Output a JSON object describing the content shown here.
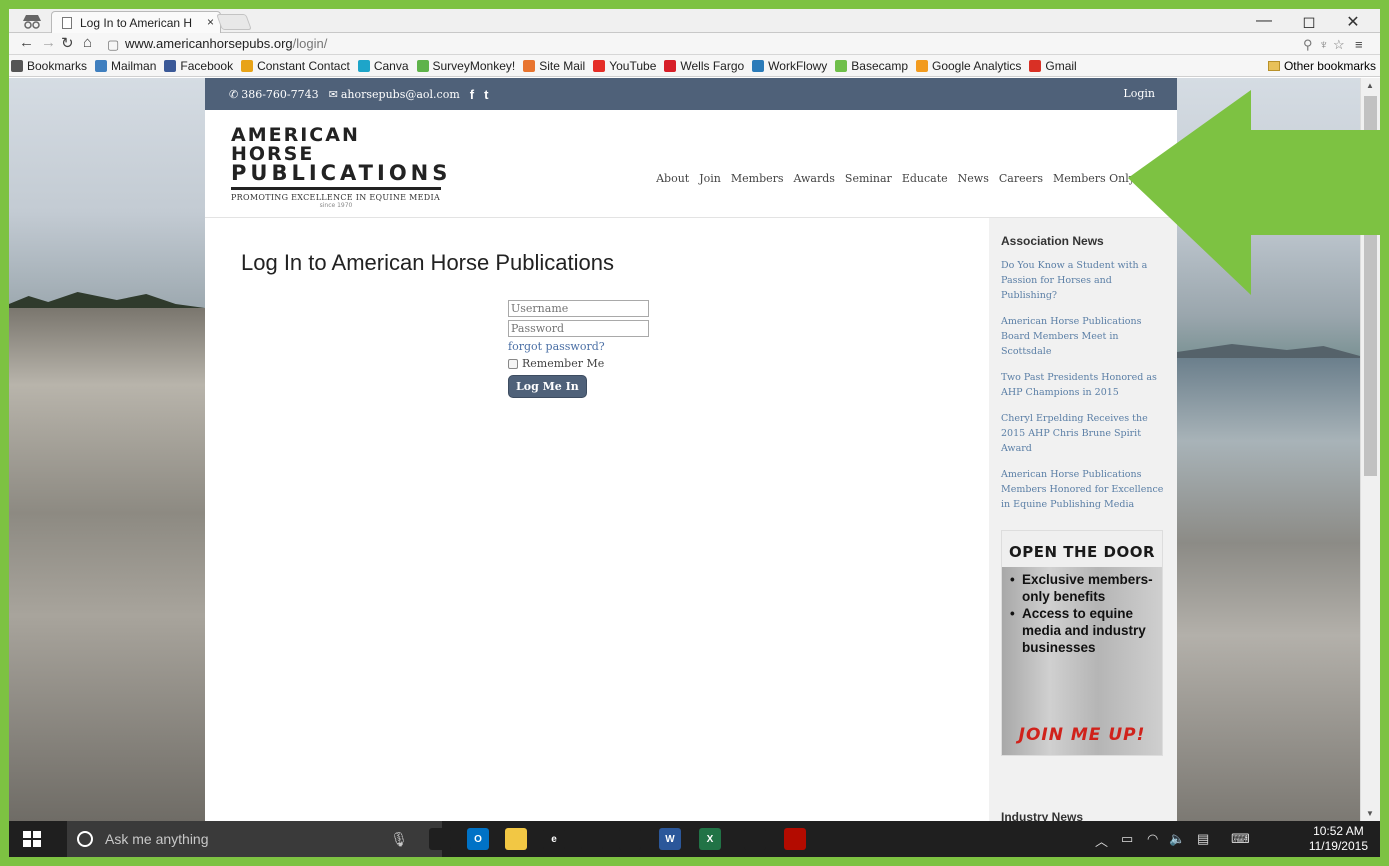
{
  "browser": {
    "tab_title": "Log In to American H",
    "tab_close": "×",
    "url_host": "www.americanhorsepubs.org",
    "url_path": "/login/",
    "window_controls": [
      "—",
      "◻",
      "✕"
    ],
    "bookmarks": [
      {
        "label": "Bookmarks",
        "icon": "star-icon",
        "color": "#555555"
      },
      {
        "label": "Mailman",
        "icon": "mailman-icon",
        "color": "#3f7fbf"
      },
      {
        "label": "Facebook",
        "icon": "facebook-icon",
        "color": "#3b5998"
      },
      {
        "label": "Constant Contact",
        "icon": "constant-contact-icon",
        "color": "#e8a317"
      },
      {
        "label": "Canva",
        "icon": "canva-icon",
        "color": "#1ea5c9"
      },
      {
        "label": "SurveyMonkey!",
        "icon": "surveymonkey-icon",
        "color": "#5fb34a"
      },
      {
        "label": "Site Mail",
        "icon": "site-mail-icon",
        "color": "#e8742f"
      },
      {
        "label": "YouTube",
        "icon": "youtube-icon",
        "color": "#e52d27"
      },
      {
        "label": "Wells Fargo",
        "icon": "wells-fargo-icon",
        "color": "#d71e28"
      },
      {
        "label": "WorkFlowy",
        "icon": "workflowy-icon",
        "color": "#2b7bb9"
      },
      {
        "label": "Basecamp",
        "icon": "basecamp-icon",
        "color": "#6fbf4a"
      },
      {
        "label": "Google Analytics",
        "icon": "google-analytics-icon",
        "color": "#f29b1f"
      },
      {
        "label": "Gmail",
        "icon": "gmail-icon",
        "color": "#d93025"
      }
    ],
    "other_bookmarks": "Other bookmarks"
  },
  "site": {
    "phone": "386-760-7743",
    "email": "ahorsepubs@aol.com",
    "social": [
      "f",
      "t"
    ],
    "login_link": "Login",
    "logo": {
      "line1": "AMERICAN HORSE",
      "line2": "PUBLICATIONS",
      "tagline": "PROMOTING EXCELLENCE IN EQUINE MEDIA",
      "since": "since 1970"
    },
    "nav": [
      "About",
      "Join",
      "Members",
      "Awards",
      "Seminar",
      "Educate",
      "News",
      "Careers",
      "Members Only"
    ],
    "page_title": "Log In to American Horse Publications",
    "form": {
      "username_placeholder": "Username",
      "password_placeholder": "Password",
      "forgot": "forgot password?",
      "remember": "Remember Me",
      "submit": "Log Me In"
    },
    "sidebar": {
      "heading": "Association News",
      "news": [
        "Do You Know a Student with a Passion for Horses and Publishing?",
        "American Horse Publications Board Members Meet in Scottsdale",
        "Two Past Presidents Honored as AHP Champions in 2015",
        "Cheryl Erpelding Receives the 2015 AHP Chris Brune Spirit Award",
        "American Horse Publications Members Honored for Excellence in Equine Publishing Media"
      ],
      "ad": {
        "headline": "OPEN THE DOOR",
        "bullets": [
          "Exclusive members-only benefits",
          "Access to equine media and industry businesses"
        ],
        "cta": "JOIN ME UP!"
      },
      "heading2": "Industry News"
    }
  },
  "taskbar": {
    "search_placeholder": "Ask me anything",
    "time": "10:52 AM",
    "date": "11/19/2015",
    "apps": [
      {
        "name": "task-view-icon",
        "label": "",
        "color": "#1f1f1f"
      },
      {
        "name": "outlook-icon",
        "label": "O",
        "color": "#0072c6"
      },
      {
        "name": "file-explorer-icon",
        "label": "",
        "color": "#f2c744"
      },
      {
        "name": "edge-icon",
        "label": "e",
        "color": "#1f1f1f"
      },
      {
        "name": "store-icon",
        "label": "",
        "color": "#1f1f1f"
      },
      {
        "name": "chrome-icon",
        "label": "",
        "color": "#1f1f1f"
      },
      {
        "name": "word-icon",
        "label": "W",
        "color": "#2b579a"
      },
      {
        "name": "excel-icon",
        "label": "X",
        "color": "#217346"
      },
      {
        "name": "snipping-tool-icon",
        "label": "",
        "color": "#1f1f1f"
      },
      {
        "name": "acrobat-icon",
        "label": "",
        "color": "#b30b00"
      }
    ]
  },
  "colors": {
    "frame": "#7dc242",
    "site_topbar": "#4f6179",
    "link": "#5b7fa6",
    "arrow": "#7dc242"
  }
}
